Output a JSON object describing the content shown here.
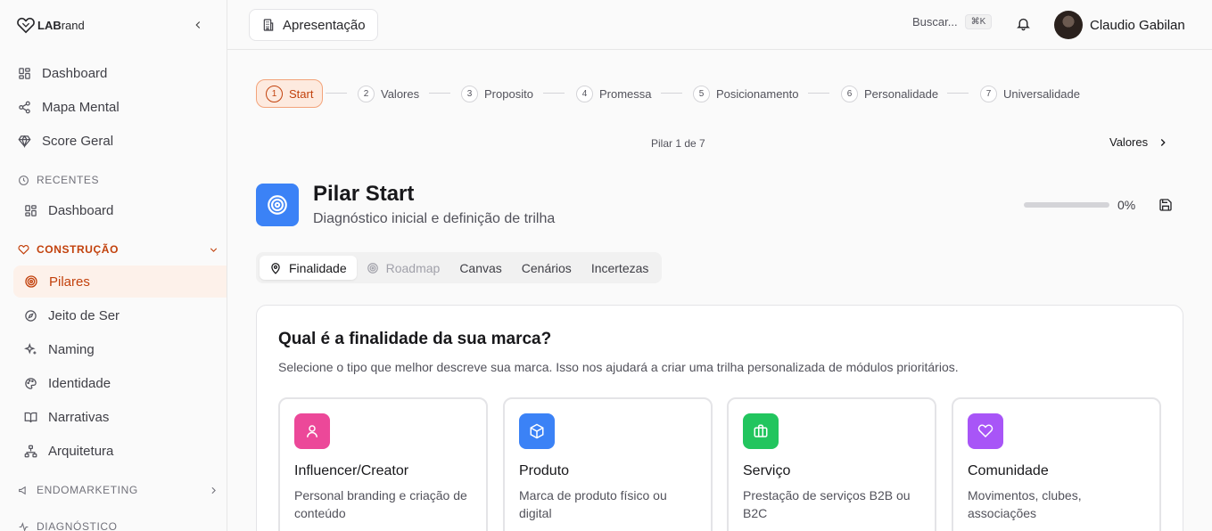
{
  "brand": {
    "logo_text_bold": "LAB",
    "logo_text_rest": "rand"
  },
  "sidebar": {
    "main_items": [
      {
        "label": "Dashboard",
        "icon": "grid-icon"
      },
      {
        "label": "Mapa Mental",
        "icon": "share-icon"
      },
      {
        "label": "Score Geral",
        "icon": "diamond-icon"
      }
    ],
    "recent_heading": "RECENTES",
    "recent_items": [
      {
        "label": "Dashboard",
        "icon": "grid-icon"
      }
    ],
    "construction_heading": "CONSTRUÇÃO",
    "construction_items": [
      {
        "label": "Pilares",
        "icon": "target-icon",
        "active": true
      },
      {
        "label": "Jeito de Ser",
        "icon": "compass-icon"
      },
      {
        "label": "Naming",
        "icon": "sparkles-icon"
      },
      {
        "label": "Identidade",
        "icon": "palette-icon"
      },
      {
        "label": "Narrativas",
        "icon": "book-icon"
      },
      {
        "label": "Arquitetura",
        "icon": "network-icon"
      }
    ],
    "endomarketing_heading": "ENDOMARKETING",
    "diagnostico_heading": "DIAGNÓSTICO"
  },
  "topbar": {
    "crumb": "Apresentação",
    "search_label": "Buscar...",
    "shortcut": "⌘K",
    "user_name": "Claudio Gabilan"
  },
  "stepper": {
    "steps": [
      {
        "n": "1",
        "label": "Start"
      },
      {
        "n": "2",
        "label": "Valores"
      },
      {
        "n": "3",
        "label": "Proposito"
      },
      {
        "n": "4",
        "label": "Promessa"
      },
      {
        "n": "5",
        "label": "Posicionamento"
      },
      {
        "n": "6",
        "label": "Personalidade"
      },
      {
        "n": "7",
        "label": "Universalidade"
      }
    ],
    "pilar_count": "Pilar 1 de 7",
    "next_label": "Valores"
  },
  "pilar": {
    "title": "Pilar Start",
    "subtitle": "Diagnóstico inicial e definição de trilha",
    "progress_pct": 0,
    "progress_label": "0%"
  },
  "tabs": [
    {
      "label": "Finalidade",
      "state": "selected"
    },
    {
      "label": "Roadmap",
      "state": "disabled"
    },
    {
      "label": "Canvas",
      "state": "normal"
    },
    {
      "label": "Cenários",
      "state": "normal"
    },
    {
      "label": "Incertezas",
      "state": "normal"
    }
  ],
  "question": {
    "title": "Qual é a finalidade da sua marca?",
    "description": "Selecione o tipo que melhor descreve sua marca. Isso nos ajudará a criar uma trilha personalizada de módulos prioritários.",
    "options": [
      {
        "title": "Influencer/Creator",
        "desc": "Personal branding e criação de conteúdo",
        "color": "#ec4899",
        "icon": "user-icon"
      },
      {
        "title": "Produto",
        "desc": "Marca de produto físico ou digital",
        "color": "#3b82f6",
        "icon": "box-icon"
      },
      {
        "title": "Serviço",
        "desc": "Prestação de serviços B2B ou B2C",
        "color": "#22c55e",
        "icon": "briefcase-icon"
      },
      {
        "title": "Comunidade",
        "desc": "Movimentos, clubes, associações",
        "color": "#a855f7",
        "icon": "heart-icon"
      }
    ]
  },
  "colors": {
    "accent": "#c2410c",
    "accent_bg": "#fdf1ea"
  }
}
